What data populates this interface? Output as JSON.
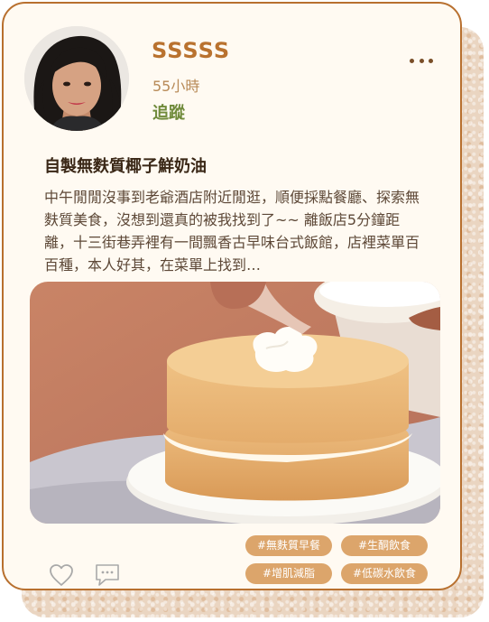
{
  "user": {
    "name": "SSSSS",
    "time": "55小時",
    "follow_label": "追蹤"
  },
  "post": {
    "title": "自製無麩質椰子鮮奶油",
    "body": "中午閒閒沒事到老爺酒店附近閒逛，順便採點餐廳、探索無麩質美食，沒想到還真的被我找到了~~ 離飯店5分鐘距離，十三街巷弄裡有一間飄香古早味台式飯館，店裡菜單百百種，本人好其，在菜單上找到…"
  },
  "tags": [
    "#無麩質早餐",
    "#生酮飲食",
    "#增肌減脂",
    "#低碳水飲食"
  ],
  "icons": {
    "more": "more-dots-icon",
    "like": "heart-icon",
    "comment": "comment-icon"
  },
  "colors": {
    "border": "#b8702f",
    "username": "#b9722f",
    "follow": "#6f8a3a",
    "tag_bg": "#dca56b",
    "card_bg": "#fffaf2"
  }
}
